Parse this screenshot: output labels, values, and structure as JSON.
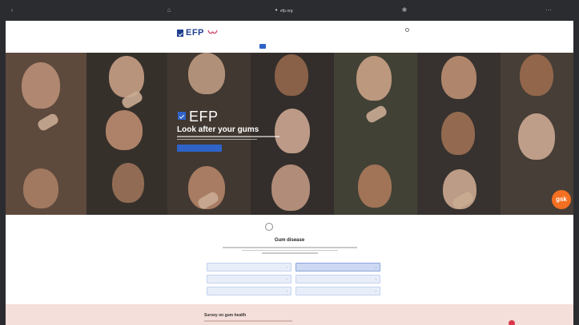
{
  "browser": {
    "back_icon": "chevron-left-icon",
    "home_icon": "home-icon",
    "lock_icon": "lock-icon",
    "url": "efp.org",
    "extension_icon": "puzzle-icon",
    "menu_icon": "menu-icon"
  },
  "header": {
    "logo_text": "EFP",
    "logo_subtitle": "",
    "top_links": [
      "",
      "",
      ""
    ],
    "search_icon": "search-icon",
    "nav": [
      "",
      "",
      "",
      "",
      "",
      ""
    ]
  },
  "hero": {
    "logo_text": "EFP",
    "title": "Look after your gums",
    "button_label": "",
    "partner_text": "",
    "sponsor_logo": "gsk"
  },
  "gum_disease": {
    "icon": "tooth-icon",
    "title": "Gum disease",
    "options": [
      "",
      "",
      "",
      "",
      "",
      ""
    ],
    "selected_index": 1
  },
  "survey": {
    "title": "Survey on gum health"
  },
  "colors": {
    "brand_blue": "#1f3f8f",
    "accent_blue": "#2f63c8",
    "gsk_orange": "#f36f21",
    "survey_bg": "#f5dfda"
  }
}
